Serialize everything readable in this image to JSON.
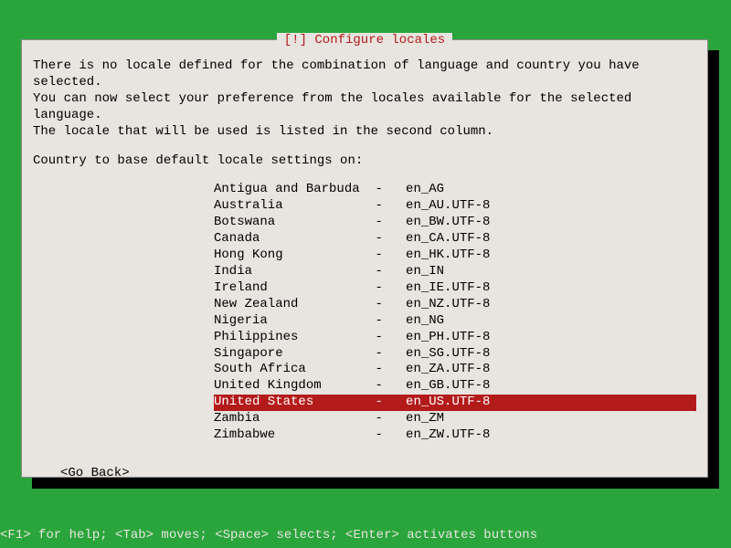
{
  "dialog": {
    "title": "[!] Configure locales",
    "intro": "There is no locale defined for the combination of language and country you have selected.\nYou can now select your preference from the locales available for the selected language.\nThe locale that will be used is listed in the second column.",
    "prompt": "Country to base default locale settings on:",
    "locales": [
      {
        "country": "Antigua and Barbuda",
        "code": "en_AG",
        "selected": false
      },
      {
        "country": "Australia",
        "code": "en_AU.UTF-8",
        "selected": false
      },
      {
        "country": "Botswana",
        "code": "en_BW.UTF-8",
        "selected": false
      },
      {
        "country": "Canada",
        "code": "en_CA.UTF-8",
        "selected": false
      },
      {
        "country": "Hong Kong",
        "code": "en_HK.UTF-8",
        "selected": false
      },
      {
        "country": "India",
        "code": "en_IN",
        "selected": false
      },
      {
        "country": "Ireland",
        "code": "en_IE.UTF-8",
        "selected": false
      },
      {
        "country": "New Zealand",
        "code": "en_NZ.UTF-8",
        "selected": false
      },
      {
        "country": "Nigeria",
        "code": "en_NG",
        "selected": false
      },
      {
        "country": "Philippines",
        "code": "en_PH.UTF-8",
        "selected": false
      },
      {
        "country": "Singapore",
        "code": "en_SG.UTF-8",
        "selected": false
      },
      {
        "country": "South Africa",
        "code": "en_ZA.UTF-8",
        "selected": false
      },
      {
        "country": "United Kingdom",
        "code": "en_GB.UTF-8",
        "selected": false
      },
      {
        "country": "United States",
        "code": "en_US.UTF-8",
        "selected": true
      },
      {
        "country": "Zambia",
        "code": "en_ZM",
        "selected": false
      },
      {
        "country": "Zimbabwe",
        "code": "en_ZW.UTF-8",
        "selected": false
      }
    ],
    "go_back": "<Go Back>"
  },
  "help_bar": "<F1> for help; <Tab> moves; <Space> selects; <Enter> activates buttons"
}
